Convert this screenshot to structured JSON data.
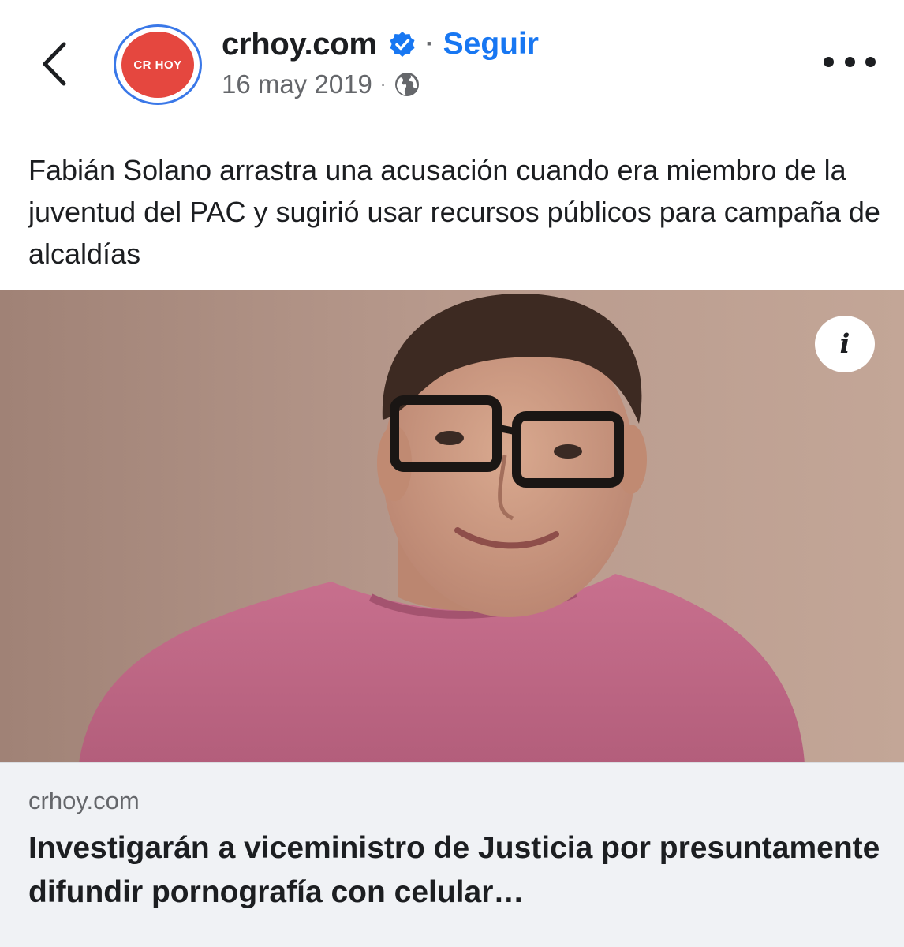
{
  "header": {
    "back_icon": "chevron-left-icon",
    "avatar_text": "CR HOY",
    "page_name": "crhoy.com",
    "verified_icon": "verified-badge-icon",
    "separator": "·",
    "follow_label": "Seguir",
    "date": "16 may 2019",
    "meta_separator": "·",
    "audience_icon": "globe-icon",
    "more_icon": "more-horizontal-icon"
  },
  "post": {
    "text": "Fabián Solano arrastra una acusación cuando era miembro de la juventud del PAC y sugirió usar recursos públicos para campaña de alcaldías"
  },
  "media": {
    "info_icon": "info-icon",
    "info_glyph": "i"
  },
  "link_preview": {
    "domain": "crhoy.com",
    "title": "Investigarán a viceministro de Justicia por presuntamente difundir pornografía con celular…"
  },
  "colors": {
    "accent": "#1877f2",
    "avatar_bg": "#e5473f",
    "avatar_ring": "#3a78e8",
    "secondary_text": "#65676b",
    "card_bg": "#f0f2f5",
    "photo_bg": "#b7978a",
    "shirt": "#c56f8c"
  }
}
